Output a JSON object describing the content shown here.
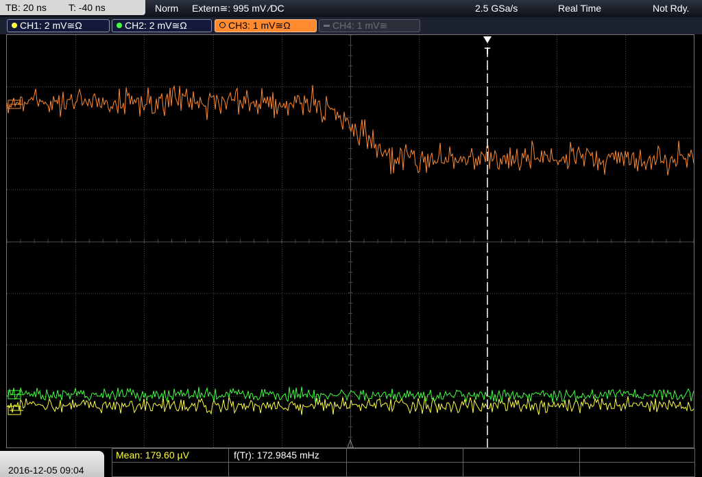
{
  "topbar": {
    "timebase": "TB: 20 ns",
    "trigger_offset": "T: -40 ns",
    "mode": "Norm",
    "trigger_source": "Extern≅: 995 mV ⁄DC",
    "sample_rate": "2.5 GSa/s",
    "acq_mode": "Real Time",
    "status": "Not Rdy."
  },
  "channels": [
    {
      "label": "CH1: 2 mV≅Ω",
      "color": "#ffff40"
    },
    {
      "label": "CH2: 2 mV≅Ω",
      "color": "#40ff40"
    },
    {
      "label": "CH3: 1 mV≅Ω",
      "color": "#ff8a30"
    },
    {
      "label": "CH4: 1 mV≅",
      "color": "#6a6f7a"
    }
  ],
  "trigger_marker": "T",
  "bottombar": {
    "datetime": "2016-12-05 09:04",
    "measurement_1": "Mean: 179.60 µV",
    "measurement_2": "f(Tr): 172.9845 mHz"
  },
  "colors": {
    "ch1": "#ffff40",
    "ch2": "#40ff40",
    "ch3": "#ff8a30",
    "grid": "#4a4a4a"
  }
}
